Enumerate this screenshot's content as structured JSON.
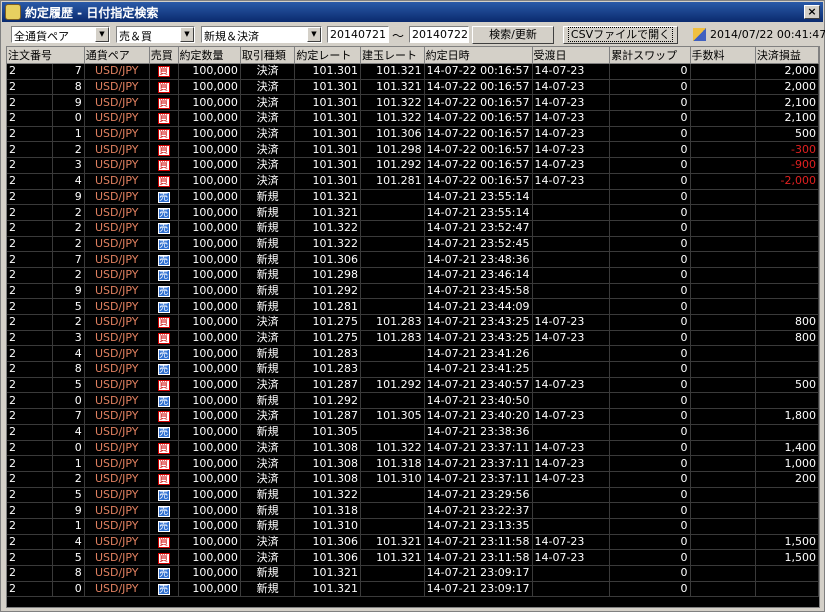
{
  "window": {
    "title": "約定履歴 - 日付指定検索",
    "close_label": "×"
  },
  "toolbar": {
    "pair_filter": "全通貨ペア",
    "side_filter": "売＆買",
    "type_filter": "新規＆決済",
    "date_from": "20140721",
    "date_sep": "〜",
    "date_to": "20140722",
    "search_label": "検索/更新",
    "csv_label": "CSVファイルで開く",
    "datetime": "2014/07/22 00:41:47"
  },
  "columns": [
    "注文番号",
    "通貨ペア",
    "売買",
    "約定数量",
    "取引種類",
    "約定レート",
    "建玉レート",
    "約定日時",
    "受渡日",
    "累計スワップ",
    "手数料",
    "決済損益"
  ],
  "colors": {
    "buy": "#d00000",
    "sell": "#3070d0",
    "pair": "#e08060",
    "loss": "#e02020"
  },
  "rows": [
    {
      "order_a": "2",
      "order_b": "7",
      "pair": "USD/JPY",
      "side": "買",
      "qty": "100,000",
      "type": "決済",
      "rate": "101.301",
      "open_rate": "101.321",
      "datetime": "14-07-22 00:16:57",
      "settle": "14-07-23",
      "swap": "0",
      "fee": "",
      "pl": "2,000"
    },
    {
      "order_a": "2",
      "order_b": "8",
      "pair": "USD/JPY",
      "side": "買",
      "qty": "100,000",
      "type": "決済",
      "rate": "101.301",
      "open_rate": "101.321",
      "datetime": "14-07-22 00:16:57",
      "settle": "14-07-23",
      "swap": "0",
      "fee": "",
      "pl": "2,000"
    },
    {
      "order_a": "2",
      "order_b": "9",
      "pair": "USD/JPY",
      "side": "買",
      "qty": "100,000",
      "type": "決済",
      "rate": "101.301",
      "open_rate": "101.322",
      "datetime": "14-07-22 00:16:57",
      "settle": "14-07-23",
      "swap": "0",
      "fee": "",
      "pl": "2,100"
    },
    {
      "order_a": "2",
      "order_b": "0",
      "pair": "USD/JPY",
      "side": "買",
      "qty": "100,000",
      "type": "決済",
      "rate": "101.301",
      "open_rate": "101.322",
      "datetime": "14-07-22 00:16:57",
      "settle": "14-07-23",
      "swap": "0",
      "fee": "",
      "pl": "2,100"
    },
    {
      "order_a": "2",
      "order_b": "1",
      "pair": "USD/JPY",
      "side": "買",
      "qty": "100,000",
      "type": "決済",
      "rate": "101.301",
      "open_rate": "101.306",
      "datetime": "14-07-22 00:16:57",
      "settle": "14-07-23",
      "swap": "0",
      "fee": "",
      "pl": "500"
    },
    {
      "order_a": "2",
      "order_b": "2",
      "pair": "USD/JPY",
      "side": "買",
      "qty": "100,000",
      "type": "決済",
      "rate": "101.301",
      "open_rate": "101.298",
      "datetime": "14-07-22 00:16:57",
      "settle": "14-07-23",
      "swap": "0",
      "fee": "",
      "pl": "-300"
    },
    {
      "order_a": "2",
      "order_b": "3",
      "pair": "USD/JPY",
      "side": "買",
      "qty": "100,000",
      "type": "決済",
      "rate": "101.301",
      "open_rate": "101.292",
      "datetime": "14-07-22 00:16:57",
      "settle": "14-07-23",
      "swap": "0",
      "fee": "",
      "pl": "-900"
    },
    {
      "order_a": "2",
      "order_b": "4",
      "pair": "USD/JPY",
      "side": "買",
      "qty": "100,000",
      "type": "決済",
      "rate": "101.301",
      "open_rate": "101.281",
      "datetime": "14-07-22 00:16:57",
      "settle": "14-07-23",
      "swap": "0",
      "fee": "",
      "pl": "-2,000"
    },
    {
      "order_a": "2",
      "order_b": "9",
      "pair": "USD/JPY",
      "side": "売",
      "qty": "100,000",
      "type": "新規",
      "rate": "101.321",
      "open_rate": "",
      "datetime": "14-07-21 23:55:14",
      "settle": "",
      "swap": "0",
      "fee": "",
      "pl": ""
    },
    {
      "order_a": "2",
      "order_b": "2",
      "pair": "USD/JPY",
      "side": "売",
      "qty": "100,000",
      "type": "新規",
      "rate": "101.321",
      "open_rate": "",
      "datetime": "14-07-21 23:55:14",
      "settle": "",
      "swap": "0",
      "fee": "",
      "pl": ""
    },
    {
      "order_a": "2",
      "order_b": "2",
      "pair": "USD/JPY",
      "side": "売",
      "qty": "100,000",
      "type": "新規",
      "rate": "101.322",
      "open_rate": "",
      "datetime": "14-07-21 23:52:47",
      "settle": "",
      "swap": "0",
      "fee": "",
      "pl": ""
    },
    {
      "order_a": "2",
      "order_b": "2",
      "pair": "USD/JPY",
      "side": "売",
      "qty": "100,000",
      "type": "新規",
      "rate": "101.322",
      "open_rate": "",
      "datetime": "14-07-21 23:52:45",
      "settle": "",
      "swap": "0",
      "fee": "",
      "pl": ""
    },
    {
      "order_a": "2",
      "order_b": "7",
      "pair": "USD/JPY",
      "side": "売",
      "qty": "100,000",
      "type": "新規",
      "rate": "101.306",
      "open_rate": "",
      "datetime": "14-07-21 23:48:36",
      "settle": "",
      "swap": "0",
      "fee": "",
      "pl": ""
    },
    {
      "order_a": "2",
      "order_b": "2",
      "pair": "USD/JPY",
      "side": "売",
      "qty": "100,000",
      "type": "新規",
      "rate": "101.298",
      "open_rate": "",
      "datetime": "14-07-21 23:46:14",
      "settle": "",
      "swap": "0",
      "fee": "",
      "pl": ""
    },
    {
      "order_a": "2",
      "order_b": "9",
      "pair": "USD/JPY",
      "side": "売",
      "qty": "100,000",
      "type": "新規",
      "rate": "101.292",
      "open_rate": "",
      "datetime": "14-07-21 23:45:58",
      "settle": "",
      "swap": "0",
      "fee": "",
      "pl": ""
    },
    {
      "order_a": "2",
      "order_b": "5",
      "pair": "USD/JPY",
      "side": "売",
      "qty": "100,000",
      "type": "新規",
      "rate": "101.281",
      "open_rate": "",
      "datetime": "14-07-21 23:44:09",
      "settle": "",
      "swap": "0",
      "fee": "",
      "pl": ""
    },
    {
      "order_a": "2",
      "order_b": "2",
      "pair": "USD/JPY",
      "side": "買",
      "qty": "100,000",
      "type": "決済",
      "rate": "101.275",
      "open_rate": "101.283",
      "datetime": "14-07-21 23:43:25",
      "settle": "14-07-23",
      "swap": "0",
      "fee": "",
      "pl": "800"
    },
    {
      "order_a": "2",
      "order_b": "3",
      "pair": "USD/JPY",
      "side": "買",
      "qty": "100,000",
      "type": "決済",
      "rate": "101.275",
      "open_rate": "101.283",
      "datetime": "14-07-21 23:43:25",
      "settle": "14-07-23",
      "swap": "0",
      "fee": "",
      "pl": "800"
    },
    {
      "order_a": "2",
      "order_b": "4",
      "pair": "USD/JPY",
      "side": "売",
      "qty": "100,000",
      "type": "新規",
      "rate": "101.283",
      "open_rate": "",
      "datetime": "14-07-21 23:41:26",
      "settle": "",
      "swap": "0",
      "fee": "",
      "pl": ""
    },
    {
      "order_a": "2",
      "order_b": "8",
      "pair": "USD/JPY",
      "side": "売",
      "qty": "100,000",
      "type": "新規",
      "rate": "101.283",
      "open_rate": "",
      "datetime": "14-07-21 23:41:25",
      "settle": "",
      "swap": "0",
      "fee": "",
      "pl": ""
    },
    {
      "order_a": "2",
      "order_b": "5",
      "pair": "USD/JPY",
      "side": "買",
      "qty": "100,000",
      "type": "決済",
      "rate": "101.287",
      "open_rate": "101.292",
      "datetime": "14-07-21 23:40:57",
      "settle": "14-07-23",
      "swap": "0",
      "fee": "",
      "pl": "500"
    },
    {
      "order_a": "2",
      "order_b": "0",
      "pair": "USD/JPY",
      "side": "売",
      "qty": "100,000",
      "type": "新規",
      "rate": "101.292",
      "open_rate": "",
      "datetime": "14-07-21 23:40:50",
      "settle": "",
      "swap": "0",
      "fee": "",
      "pl": ""
    },
    {
      "order_a": "2",
      "order_b": "7",
      "pair": "USD/JPY",
      "side": "買",
      "qty": "100,000",
      "type": "決済",
      "rate": "101.287",
      "open_rate": "101.305",
      "datetime": "14-07-21 23:40:20",
      "settle": "14-07-23",
      "swap": "0",
      "fee": "",
      "pl": "1,800"
    },
    {
      "order_a": "2",
      "order_b": "4",
      "pair": "USD/JPY",
      "side": "売",
      "qty": "100,000",
      "type": "新規",
      "rate": "101.305",
      "open_rate": "",
      "datetime": "14-07-21 23:38:36",
      "settle": "",
      "swap": "0",
      "fee": "",
      "pl": ""
    },
    {
      "order_a": "2",
      "order_b": "0",
      "pair": "USD/JPY",
      "side": "買",
      "qty": "100,000",
      "type": "決済",
      "rate": "101.308",
      "open_rate": "101.322",
      "datetime": "14-07-21 23:37:11",
      "settle": "14-07-23",
      "swap": "0",
      "fee": "",
      "pl": "1,400"
    },
    {
      "order_a": "2",
      "order_b": "1",
      "pair": "USD/JPY",
      "side": "買",
      "qty": "100,000",
      "type": "決済",
      "rate": "101.308",
      "open_rate": "101.318",
      "datetime": "14-07-21 23:37:11",
      "settle": "14-07-23",
      "swap": "0",
      "fee": "",
      "pl": "1,000"
    },
    {
      "order_a": "2",
      "order_b": "2",
      "pair": "USD/JPY",
      "side": "買",
      "qty": "100,000",
      "type": "決済",
      "rate": "101.308",
      "open_rate": "101.310",
      "datetime": "14-07-21 23:37:11",
      "settle": "14-07-23",
      "swap": "0",
      "fee": "",
      "pl": "200"
    },
    {
      "order_a": "2",
      "order_b": "5",
      "pair": "USD/JPY",
      "side": "売",
      "qty": "100,000",
      "type": "新規",
      "rate": "101.322",
      "open_rate": "",
      "datetime": "14-07-21 23:29:56",
      "settle": "",
      "swap": "0",
      "fee": "",
      "pl": ""
    },
    {
      "order_a": "2",
      "order_b": "9",
      "pair": "USD/JPY",
      "side": "売",
      "qty": "100,000",
      "type": "新規",
      "rate": "101.318",
      "open_rate": "",
      "datetime": "14-07-21 23:22:37",
      "settle": "",
      "swap": "0",
      "fee": "",
      "pl": ""
    },
    {
      "order_a": "2",
      "order_b": "1",
      "pair": "USD/JPY",
      "side": "売",
      "qty": "100,000",
      "type": "新規",
      "rate": "101.310",
      "open_rate": "",
      "datetime": "14-07-21 23:13:35",
      "settle": "",
      "swap": "0",
      "fee": "",
      "pl": ""
    },
    {
      "order_a": "2",
      "order_b": "4",
      "pair": "USD/JPY",
      "side": "買",
      "qty": "100,000",
      "type": "決済",
      "rate": "101.306",
      "open_rate": "101.321",
      "datetime": "14-07-21 23:11:58",
      "settle": "14-07-23",
      "swap": "0",
      "fee": "",
      "pl": "1,500"
    },
    {
      "order_a": "2",
      "order_b": "5",
      "pair": "USD/JPY",
      "side": "買",
      "qty": "100,000",
      "type": "決済",
      "rate": "101.306",
      "open_rate": "101.321",
      "datetime": "14-07-21 23:11:58",
      "settle": "14-07-23",
      "swap": "0",
      "fee": "",
      "pl": "1,500"
    },
    {
      "order_a": "2",
      "order_b": "8",
      "pair": "USD/JPY",
      "side": "売",
      "qty": "100,000",
      "type": "新規",
      "rate": "101.321",
      "open_rate": "",
      "datetime": "14-07-21 23:09:17",
      "settle": "",
      "swap": "0",
      "fee": "",
      "pl": ""
    },
    {
      "order_a": "2",
      "order_b": "0",
      "pair": "USD/JPY",
      "side": "売",
      "qty": "100,000",
      "type": "新規",
      "rate": "101.321",
      "open_rate": "",
      "datetime": "14-07-21 23:09:17",
      "settle": "",
      "swap": "0",
      "fee": "",
      "pl": ""
    }
  ]
}
